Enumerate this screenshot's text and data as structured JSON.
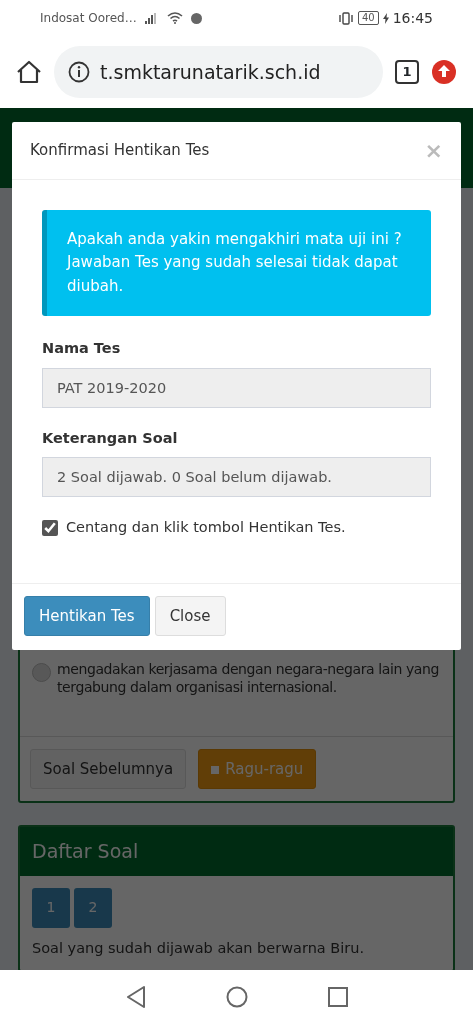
{
  "status_bar": {
    "carrier": "Indosat Oored…",
    "battery": "40",
    "time": "16:45"
  },
  "browser": {
    "url": "t.smktarunatarik.sch.id",
    "tab_count": "1"
  },
  "page": {
    "option": {
      "text": "mengadakan kerjasama dengan negara-negara lain yang tergabung dalam organisasi internasional.",
      "selected": false
    },
    "nav_buttons": [
      {
        "label": "Soal Sebelumnya",
        "kind": "default"
      },
      {
        "label": "Ragu-ragu",
        "kind": "warning"
      }
    ],
    "question_list": {
      "title": "Daftar Soal",
      "items": [
        {
          "label": "1",
          "answered": true
        },
        {
          "label": "2",
          "answered": true
        }
      ],
      "note": "Soal yang sudah dijawab akan berwarna Biru."
    }
  },
  "modal": {
    "title": "Konfirmasi Hentikan Tes",
    "close": "×",
    "alert": "Apakah anda yakin mengakhiri mata uji ini ? Jawaban Tes yang sudah selesai tidak dapat diubah.",
    "fields": [
      {
        "label": "Nama Tes",
        "value": "PAT 2019-2020"
      },
      {
        "label": "Keterangan Soal",
        "value": "2 Soal dijawab. 0 Soal belum dijawab."
      }
    ],
    "confirm": {
      "label": "Centang dan klik tombol Hentikan Tes.",
      "checked": true
    },
    "buttons": [
      {
        "label": "Hentikan Tes",
        "kind": "primary"
      },
      {
        "label": "Close",
        "kind": "default"
      }
    ]
  }
}
